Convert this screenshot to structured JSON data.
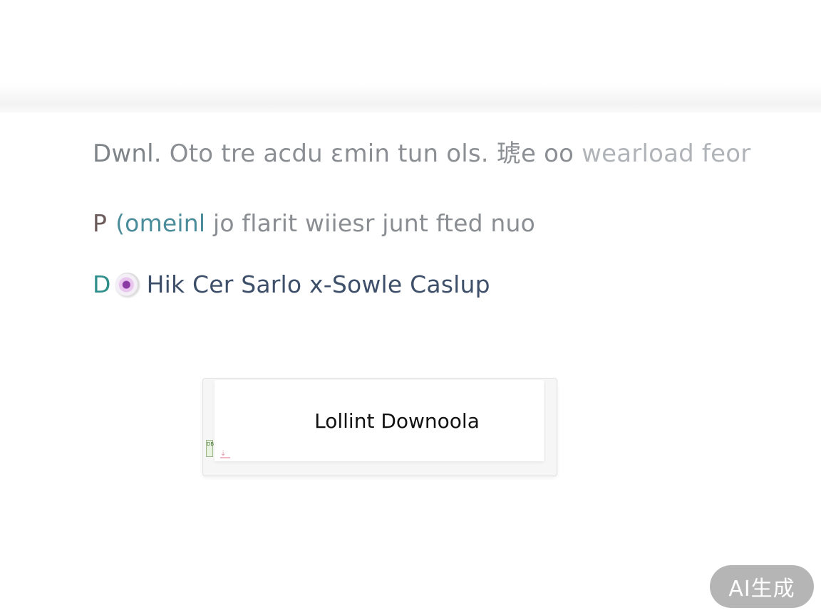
{
  "text_lines": [
    {
      "lead": "Dwnl.",
      "rest": " Oto tre acdu ɛmin tun ols. 琥e oo",
      "tail": " wearload feor"
    },
    {
      "mark": "P",
      "teal": "(omeinl",
      "rest": " jo flarit wiiesr junt fted nuo"
    },
    {
      "mark": "D",
      "text": "Hik Cer Sarlo x-Sowle Caslup"
    }
  ],
  "download_card": {
    "label": "Lollint Downoola",
    "icon": "document-icon",
    "icon_text": "DB"
  },
  "badge": {
    "label": "AI生成"
  },
  "colors": {
    "text_gray": "#8b8f93",
    "teal": "#4a8c99",
    "dark_blue": "#3e4f6a",
    "badge_bg": "#a0a0a0"
  }
}
